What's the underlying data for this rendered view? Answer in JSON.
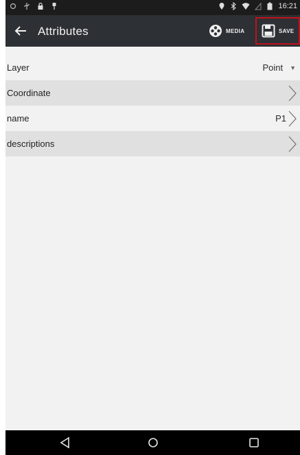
{
  "status_bar": {
    "left_icons": [
      "circle-status-icon",
      "usb-icon",
      "lock-icon",
      "pin-icon"
    ],
    "right_icons": [
      "location-icon",
      "bluetooth-icon",
      "wifi-icon",
      "signal-icon",
      "battery-icon"
    ],
    "time": "16:21"
  },
  "app_bar": {
    "title": "Attributes",
    "media_label": "MEDIA",
    "save_label": "SAVE",
    "highlight_color": "#c0121b"
  },
  "rows": [
    {
      "label": "Layer",
      "value": "Point"
    },
    {
      "label": "Coordinate",
      "value": ""
    },
    {
      "label": "name",
      "value": "P1"
    },
    {
      "label": "descriptions",
      "value": ""
    }
  ],
  "nav_bar": [
    "back-triangle-icon",
    "home-circle-icon",
    "recents-square-icon"
  ]
}
